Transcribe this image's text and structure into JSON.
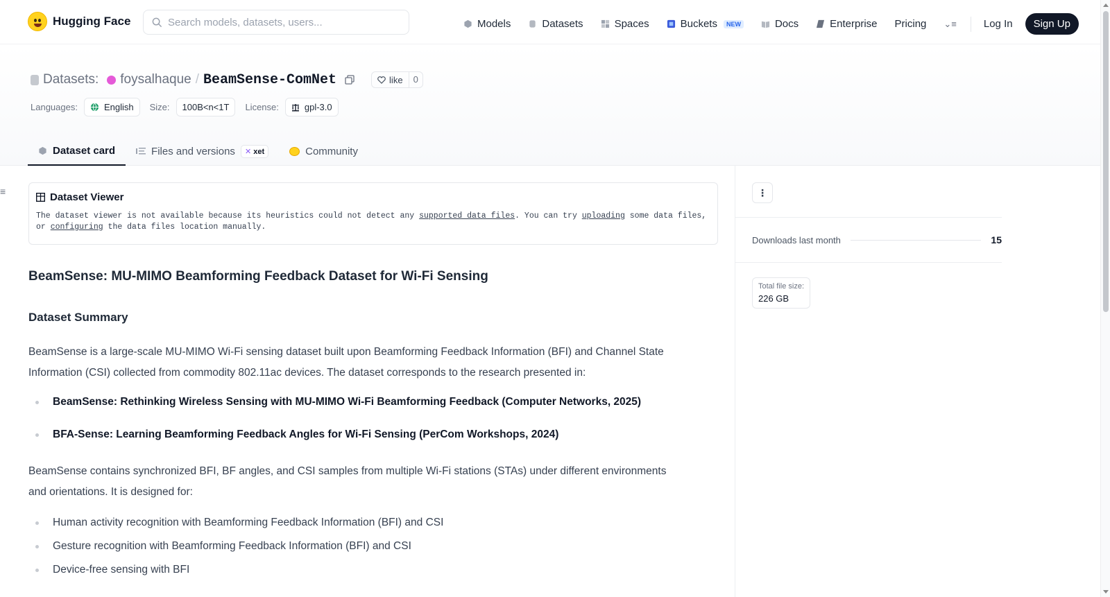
{
  "nav": {
    "brand": "Hugging Face",
    "search_placeholder": "Search models, datasets, users...",
    "links": {
      "models": "Models",
      "datasets": "Datasets",
      "spaces": "Spaces",
      "buckets": "Buckets",
      "buckets_badge": "NEW",
      "docs": "Docs",
      "enterprise": "Enterprise",
      "pricing": "Pricing"
    },
    "login": "Log In",
    "signup": "Sign Up"
  },
  "header": {
    "section": "Datasets:",
    "user": "foysalhaque",
    "separator": "/",
    "repo": "BeamSense-ComNet",
    "like_label": "like",
    "like_count": "0",
    "tags": {
      "languages_label": "Languages:",
      "language": "English",
      "size_label": "Size:",
      "size": "100B<n<1T",
      "license_label": "License:",
      "license": "gpl-3.0"
    }
  },
  "tabs": {
    "dataset_card": "Dataset card",
    "files": "Files and versions",
    "files_badge": "xet",
    "community": "Community"
  },
  "viewer": {
    "title": "Dataset Viewer",
    "text_1": "The dataset viewer is not available because its heuristics could not detect any ",
    "link_1": "supported data files",
    "text_2": ". You can try ",
    "link_2": "uploading",
    "text_3": " some data files, or ",
    "link_3": "configuring",
    "text_4": " the data files location manually."
  },
  "content": {
    "title": "BeamSense: MU-MIMO Beamforming Feedback Dataset for Wi-Fi Sensing",
    "summary_heading": "Dataset Summary",
    "para_1": "BeamSense is a large-scale MU-MIMO Wi-Fi sensing dataset built upon Beamforming Feedback Information (BFI) and Channel State Information (CSI) collected from commodity 802.11ac devices. The dataset corresponds to the research presented in:",
    "papers": [
      "BeamSense: Rethinking Wireless Sensing with MU-MIMO Wi-Fi Beamforming Feedback (Computer Networks, 2025)",
      "BFA-Sense: Learning Beamforming Feedback Angles for Wi-Fi Sensing (PerCom Workshops, 2024)"
    ],
    "para_2": "BeamSense contains synchronized BFI, BF angles, and CSI samples from multiple Wi-Fi stations (STAs) under different environments and orientations. It is designed for:",
    "uses": [
      "Human activity recognition with Beamforming Feedback Information (BFI) and CSI",
      "Gesture recognition with Beamforming Feedback Information (BFI) and CSI",
      "Device-free sensing with BFI"
    ]
  },
  "sidebar": {
    "downloads_label": "Downloads last month",
    "downloads_value": "15",
    "filesize_label": "Total file size:",
    "filesize_value": "226 GB"
  }
}
